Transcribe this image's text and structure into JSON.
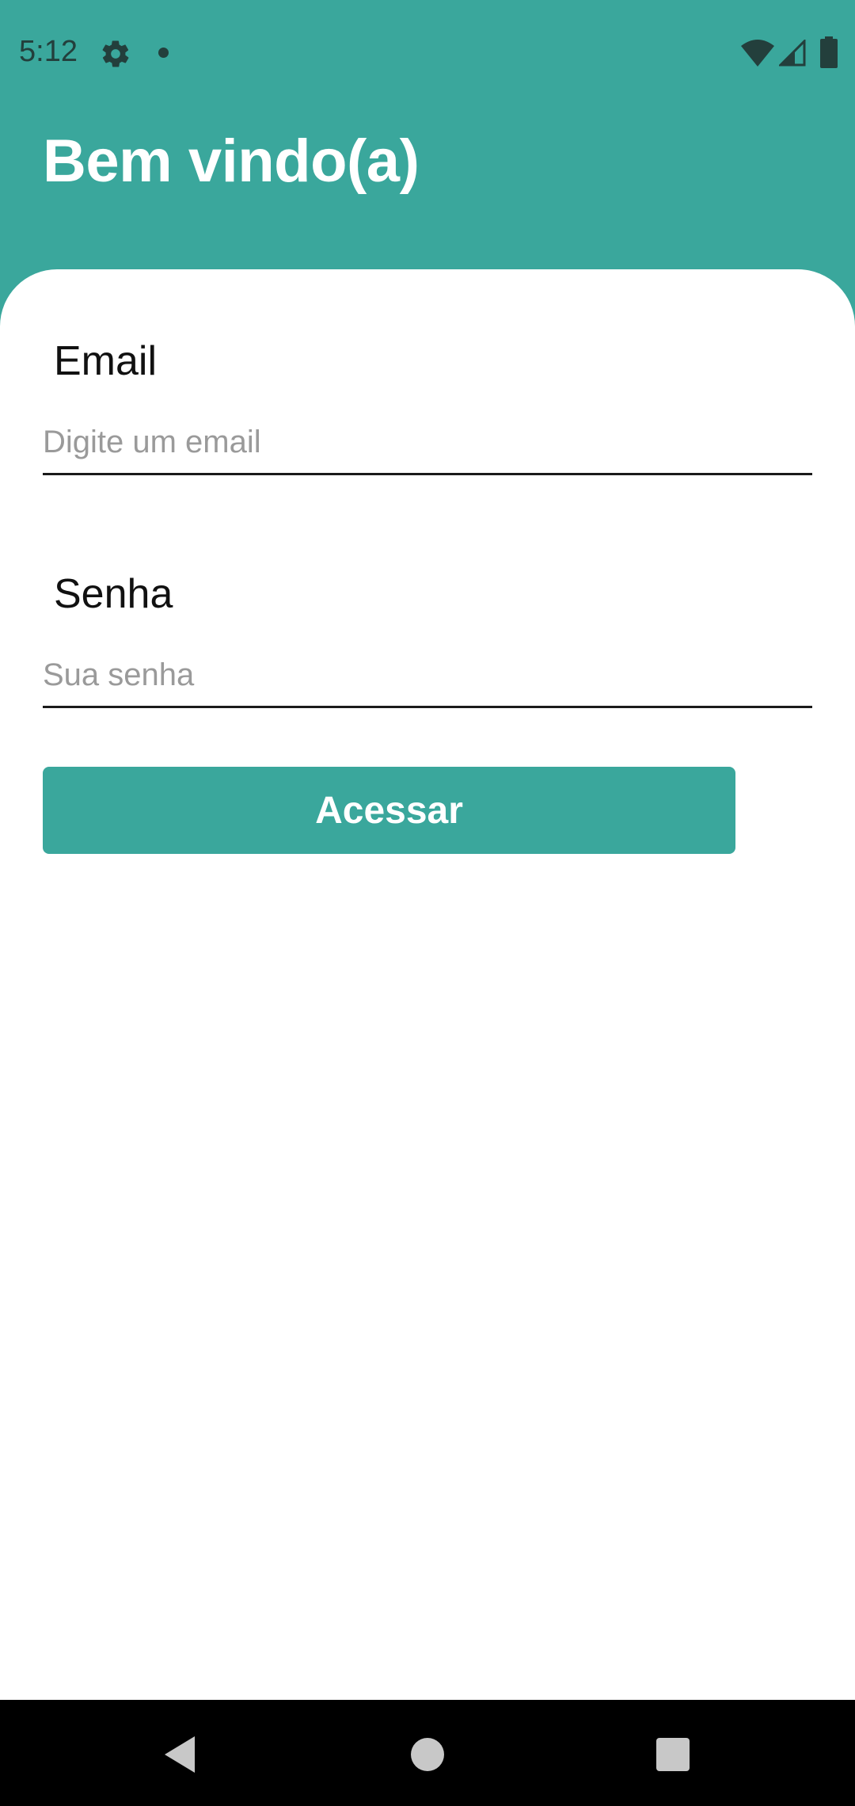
{
  "status_bar": {
    "time": "5:12",
    "icons": [
      "gear-icon",
      "notification-dot-icon",
      "wifi-icon",
      "signal-icon",
      "battery-icon"
    ]
  },
  "header": {
    "title": "Bem vindo(a)"
  },
  "form": {
    "email": {
      "label": "Email",
      "value": "",
      "placeholder": "Digite um email"
    },
    "password": {
      "label": "Senha",
      "value": "",
      "placeholder": "Sua senha"
    },
    "submit_label": "Acessar"
  },
  "nav_bar": {
    "icons": [
      "back-icon",
      "home-icon",
      "recents-icon"
    ]
  },
  "colors": {
    "accent": "#3aa79c",
    "card": "#ffffff",
    "label": "#111111",
    "placeholder": "#9a9a9a",
    "nav_bar": "#000000"
  }
}
